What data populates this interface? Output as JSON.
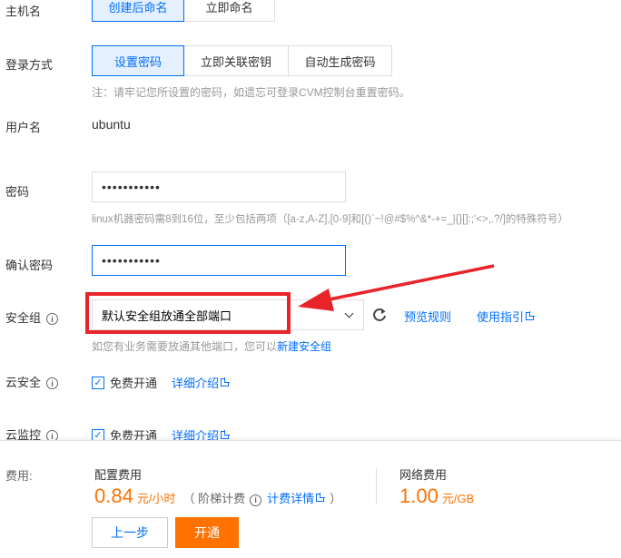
{
  "hostname": {
    "label": "主机名",
    "options": [
      "创建后命名",
      "立即命名"
    ]
  },
  "login": {
    "label": "登录方式",
    "options": [
      "设置密码",
      "立即关联密钥",
      "自动生成密码"
    ],
    "note": "注：请牢记您所设置的密码，如遗忘可登录CVM控制台重置密码。"
  },
  "username": {
    "label": "用户名",
    "value": "ubuntu"
  },
  "password": {
    "label": "密码",
    "value": "•••••••••••",
    "hint": "linux机器密码需8到16位，至少包括两项（[a-z,A-Z],[0-9]和[()`~!@#$%^&*-+=_|{}[]:;'<>,.?/]的特殊符号）"
  },
  "confirm_password": {
    "label": "确认密码",
    "value": "•••••••••••"
  },
  "security_group": {
    "label": "安全组",
    "selected": "默认安全组放通全部端口",
    "preview_link": "预览规则",
    "guide_link": "使用指引",
    "hint_prefix": "如您有业务需要放通其他端口，您可以",
    "hint_link": "新建安全组"
  },
  "cloud_security": {
    "label": "云安全",
    "checkbox_label": "免费开通",
    "detail_link": "详细介绍"
  },
  "cloud_monitor": {
    "label": "云监控",
    "checkbox_label": "免费开通",
    "detail_link": "详细介绍"
  },
  "footer": {
    "fee_label": "费用:",
    "config_fee_title": "配置费用",
    "config_price": "0.84",
    "config_unit": "元/小时",
    "tier_open": "（ 阶梯计费",
    "billing_detail_link": "计费详情",
    "tier_close": "）",
    "network_fee_title": "网络费用",
    "network_price": "1.00",
    "network_unit": "元/GB",
    "prev_button": "上一步",
    "submit_button": "开通"
  },
  "colors": {
    "accent": "#006eff",
    "price": "#ff7200",
    "annotation": "#e8242a"
  }
}
